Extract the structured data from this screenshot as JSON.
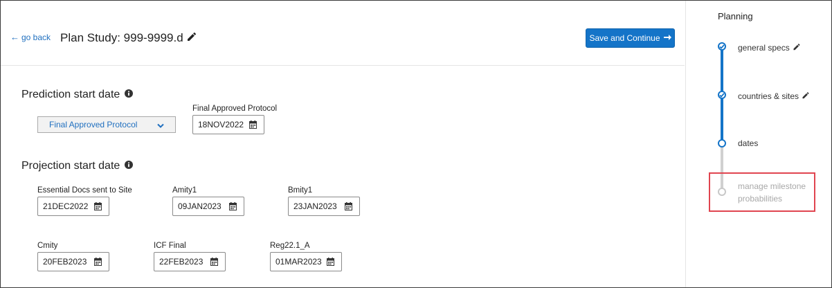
{
  "header": {
    "go_back_label": "go back",
    "title": "Plan Study: 999-9999.d",
    "save_label": "Save and Continue"
  },
  "prediction": {
    "title": "Prediction start date",
    "dropdown_value": "Final Approved Protocol",
    "field_label": "Final Approved Protocol",
    "field_value": "18NOV2022"
  },
  "projection": {
    "title": "Projection start date",
    "fields": [
      {
        "label": "Essential Docs sent to Site",
        "value": "21DEC2022"
      },
      {
        "label": "Amity1",
        "value": "09JAN2023"
      },
      {
        "label": "Bmity1",
        "value": "23JAN2023"
      },
      {
        "label": "Cmity",
        "value": "20FEB2023"
      },
      {
        "label": "ICF Final",
        "value": "22FEB2023"
      },
      {
        "label": "Reg22.1_A",
        "value": "01MAR2023"
      }
    ]
  },
  "planning": {
    "title": "Planning",
    "steps": [
      {
        "label": "general specs",
        "state": "completed"
      },
      {
        "label": "countries & sites",
        "state": "completed"
      },
      {
        "label": "dates",
        "state": "current"
      },
      {
        "label": "manage milestone probabilities",
        "state": "pending"
      }
    ]
  },
  "colors": {
    "accent": "#1474c8",
    "link": "#1f6fbf",
    "highlight": "#e0444f",
    "pending": "#c8c8c8"
  },
  "icons": [
    "arrow-left-icon",
    "pencil-icon",
    "arrow-right-icon",
    "info-icon",
    "chevron-down-icon",
    "calendar-icon",
    "check-icon"
  ]
}
